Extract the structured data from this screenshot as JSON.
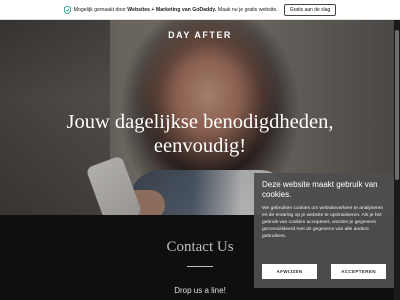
{
  "topbar": {
    "shield_icon": "shield-check-icon",
    "promo_prefix": "Mogelijk gemaakt door ",
    "promo_bold": "Websites + Marketing van GoDaddy.",
    "promo_suffix": " Maak nu je gratis website.",
    "cta_label": "Gratis aan de slag"
  },
  "brand": "DAY AFTER",
  "hero": {
    "headline_line1": "Jouw dagelijkse benodigdheden,",
    "headline_line2": "eenvoudig!"
  },
  "contact": {
    "title": "Contact Us",
    "subtitle": "Drop us a line!"
  },
  "cookie_banner": {
    "title": "Deze website maakt gebruik van cookies.",
    "body": "We gebruiken cookies om websiteverkeer te analyseren en de ervaring op je website te optimaliseren. Als je het gebruik van cookies accepteert, worden je gegevens geconsolideerd met de gegevens van alle andere gebruikers.",
    "reject_label": "AFWIJZEN",
    "accept_label": "ACCEPTEREN"
  },
  "colors": {
    "banner_bg": "#4e4e4e",
    "page_bg": "#0f0f0f",
    "button_bg": "#ffffff"
  }
}
